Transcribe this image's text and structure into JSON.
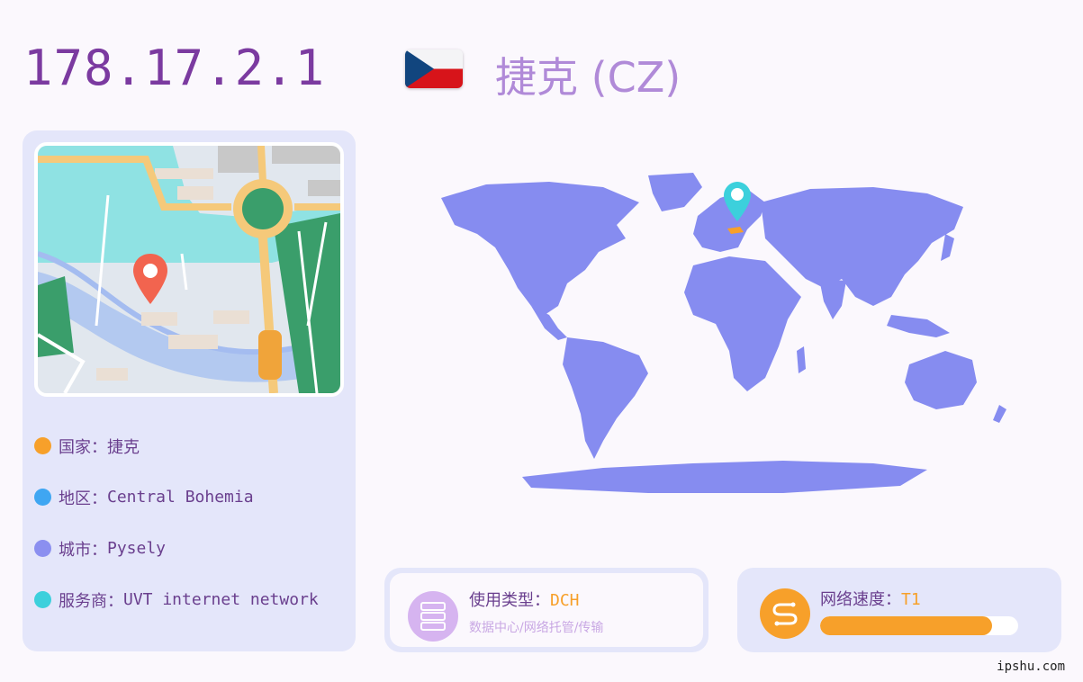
{
  "header": {
    "ip": "178.17.2.1",
    "country_title": "捷克 (CZ)",
    "flag_icon": "czech-flag-icon"
  },
  "info": {
    "items": [
      {
        "label": "国家：",
        "value": "捷克",
        "color": "#f7a02a"
      },
      {
        "label": "地区：",
        "value": "Central Bohemia",
        "color": "#3fa6f2"
      },
      {
        "label": "城市：",
        "value": "Pysely",
        "color": "#8b8ff0"
      },
      {
        "label": "服务商：",
        "value": "UVT internet network",
        "color": "#3cd0dc"
      }
    ]
  },
  "usage": {
    "label": "使用类型：",
    "value": "DCH",
    "description": "数据中心/网络托管/传输",
    "icon": "server-icon"
  },
  "speed": {
    "label": "网络速度：",
    "value": "T1",
    "level": 0.87,
    "icon": "speed-icon"
  },
  "colors": {
    "accent": "#f7a02a",
    "title_purple": "#7b3aa0",
    "map_land": "#868cf0",
    "marker_cyan": "#3cd0dc",
    "marker_red": "#f2644f"
  },
  "watermark": "ipshu.com"
}
